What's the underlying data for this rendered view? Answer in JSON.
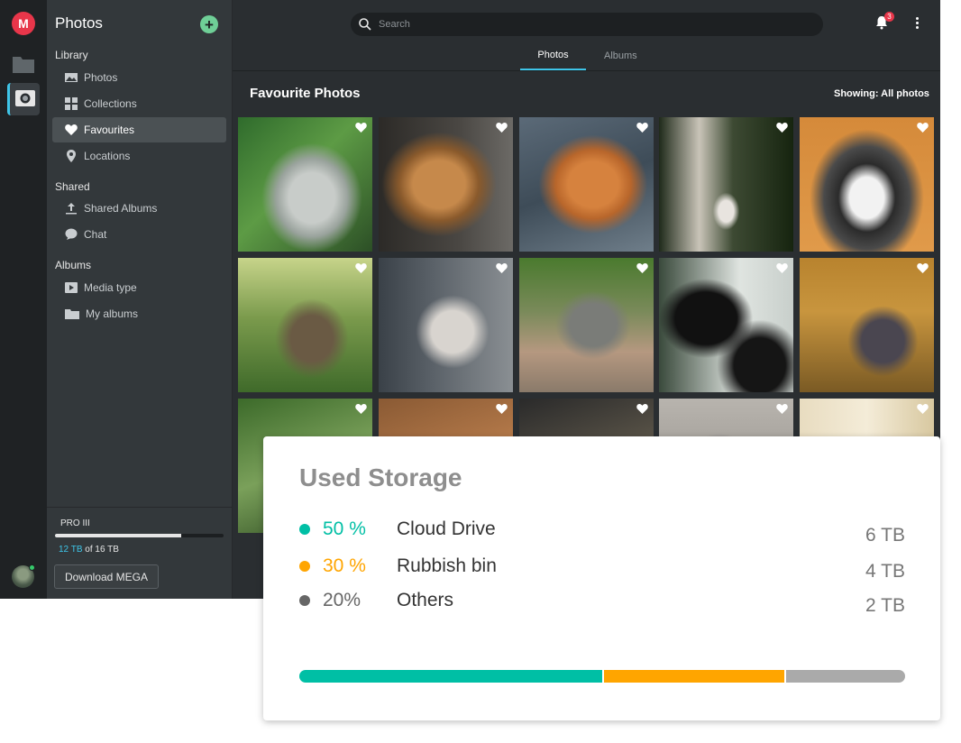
{
  "app": {
    "logo_letter": "M"
  },
  "sidebar": {
    "title": "Photos",
    "sections": {
      "library": "Library",
      "shared": "Shared",
      "albums": "Albums"
    },
    "items": [
      {
        "label": "Photos",
        "icon": "image-icon"
      },
      {
        "label": "Collections",
        "icon": "grid-icon"
      },
      {
        "label": "Favourites",
        "icon": "heart-icon",
        "active": true
      },
      {
        "label": "Locations",
        "icon": "location-pin-icon"
      },
      {
        "label": "Shared Albums",
        "icon": "upload-icon"
      },
      {
        "label": "Chat",
        "icon": "chat-bubble-icon"
      },
      {
        "label": "Media type",
        "icon": "play-icon"
      },
      {
        "label": "My albums",
        "icon": "folder-icon"
      }
    ],
    "plan": {
      "name": "PRO III",
      "used": "12 TB",
      "total_text": "of 16 TB",
      "usage_fraction": 0.75
    },
    "download_button": "Download MEGA"
  },
  "topbar": {
    "search_placeholder": "Search",
    "notification_count": "3"
  },
  "tabs": [
    {
      "label": "Photos",
      "active": true
    },
    {
      "label": "Albums",
      "active": false
    }
  ],
  "content": {
    "title": "Favourite Photos",
    "showing": "Showing: All photos"
  },
  "storage": {
    "title": "Used Storage",
    "rows": [
      {
        "percent": "50 %",
        "label": "Cloud Drive",
        "value": "6 TB",
        "color": "#00bfa5",
        "fraction": 0.5
      },
      {
        "percent": "30 %",
        "label": "Rubbish bin",
        "value": "4 TB",
        "color": "#ffa500",
        "fraction": 0.3
      },
      {
        "percent": "20%",
        "label": "Others",
        "value": "2 TB",
        "color": "#666666",
        "fraction": 0.2
      }
    ],
    "bar_colors": [
      "#00bfa5",
      "#ffa500",
      "#aaaaaa"
    ]
  }
}
